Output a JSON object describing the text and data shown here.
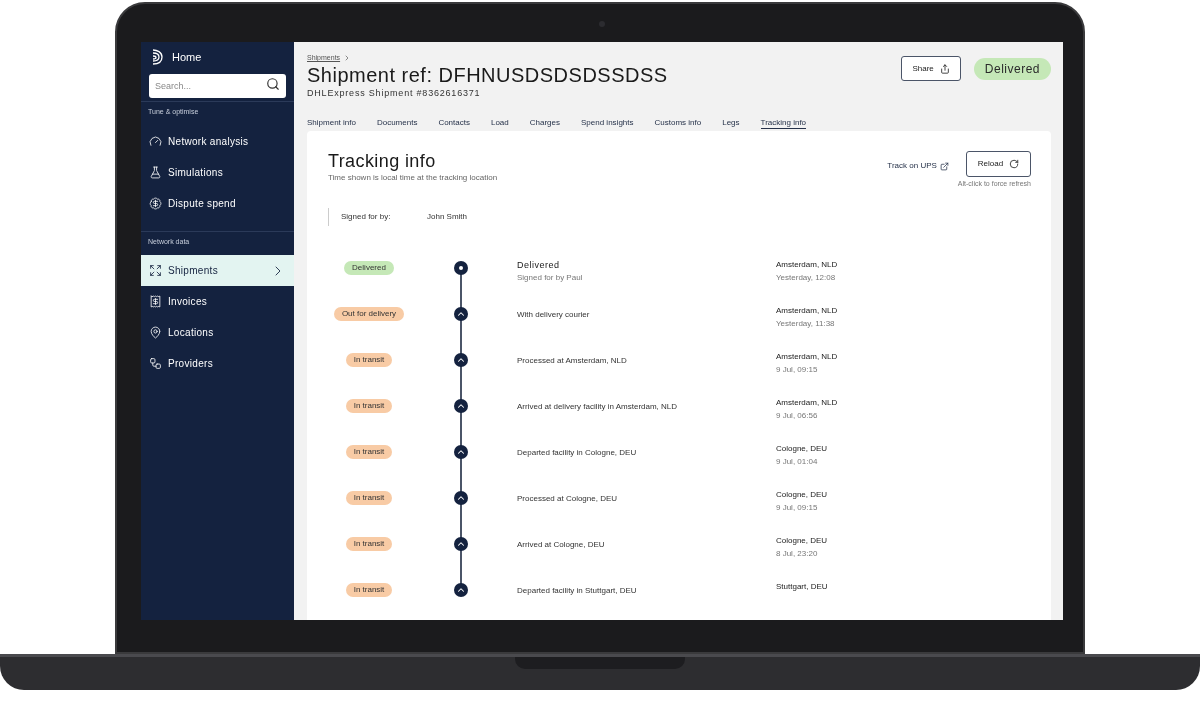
{
  "sidebar": {
    "home": "Home",
    "search": {
      "placeholder": "Search..."
    },
    "sections": [
      {
        "title": "Tune & optimise",
        "items": [
          {
            "label": "Network analysis",
            "selected": false
          },
          {
            "label": "Simulations",
            "selected": false
          },
          {
            "label": "Dispute spend",
            "selected": false
          }
        ]
      },
      {
        "title": "Network data",
        "items": [
          {
            "label": "Shipments",
            "selected": true
          },
          {
            "label": "Invoices",
            "selected": false
          },
          {
            "label": "Locations",
            "selected": false
          },
          {
            "label": "Providers",
            "selected": false
          }
        ]
      }
    ]
  },
  "header": {
    "breadcrumb": "Shipments",
    "title": "Shipment ref: DFHNUSDSDSDSSDSS",
    "subtitle": "DHLExpress Shipment #8362616371",
    "share": "Share",
    "status": "Delivered"
  },
  "tabs": [
    {
      "label": "Shipment info",
      "selected": false
    },
    {
      "label": "Documents",
      "selected": false
    },
    {
      "label": "Contacts",
      "selected": false
    },
    {
      "label": "Load",
      "selected": false
    },
    {
      "label": "Charges",
      "selected": false
    },
    {
      "label": "Spend insights",
      "selected": false
    },
    {
      "label": "Customs info",
      "selected": false
    },
    {
      "label": "Legs",
      "selected": false
    },
    {
      "label": "Tracking info",
      "selected": true
    }
  ],
  "tracking": {
    "title": "Tracking info",
    "subtitle": "Time shown is local time at the tracking location",
    "track_link": "Track on UPS",
    "reload": "Reload",
    "reload_hint": "Alt-click to force refresh",
    "signed_for": {
      "label": "Signed for by:",
      "value": "John Smith"
    },
    "events": [
      {
        "kind": "final",
        "status": "Delivered",
        "color": "#c5e8b7",
        "title": "Delivered",
        "detail": "Signed for by Paul",
        "location": "Amsterdam, NLD",
        "time": "Yesterday, 12:08"
      },
      {
        "kind": "step",
        "status": "Out for delivery",
        "color": "#f8cba5",
        "title": "With delivery courier",
        "location": "Amsterdam, NLD",
        "time": "Yesterday, 11:38"
      },
      {
        "kind": "step",
        "status": "In transit",
        "color": "#f8cba5",
        "title": "Processed at Amsterdam, NLD",
        "location": "Amsterdam, NLD",
        "time": "9 Jul, 09:15"
      },
      {
        "kind": "step",
        "status": "In transit",
        "color": "#f8cba5",
        "title": "Arrived at delivery facility in Amsterdam, NLD",
        "location": "Amsterdam, NLD",
        "time": "9 Jul, 06:56"
      },
      {
        "kind": "step",
        "status": "In transit",
        "color": "#f8cba5",
        "title": "Departed facility in Cologne, DEU",
        "location": "Cologne, DEU",
        "time": "9 Jul, 01:04"
      },
      {
        "kind": "step",
        "status": "In transit",
        "color": "#f8cba5",
        "title": "Processed at Cologne, DEU",
        "location": "Cologne, DEU",
        "time": "9 Jul, 09:15"
      },
      {
        "kind": "step",
        "status": "In transit",
        "color": "#f8cba5",
        "title": "Arrived at Cologne, DEU",
        "location": "Cologne, DEU",
        "time": "8 Jul, 23:20"
      },
      {
        "kind": "step",
        "status": "In transit",
        "color": "#f8cba5",
        "title": "Departed facility in Stuttgart, DEU",
        "location": "Stuttgart, DEU"
      }
    ]
  }
}
